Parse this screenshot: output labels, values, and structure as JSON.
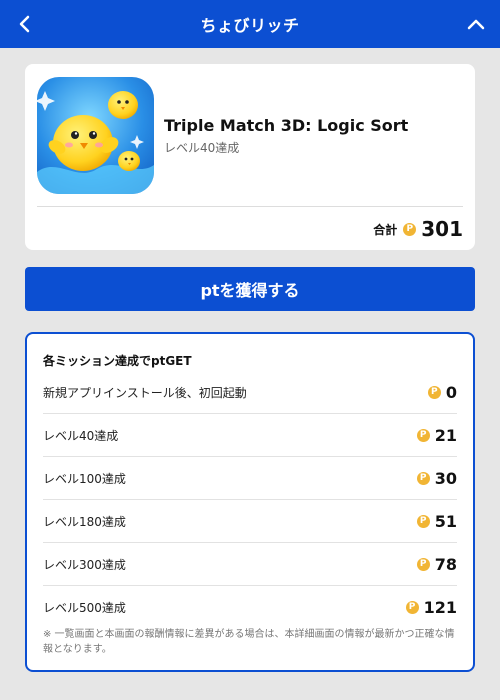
{
  "header": {
    "title": "ちょびリッチ"
  },
  "app": {
    "name": "Triple Match 3D: Logic Sort",
    "subtitle": "レベル40達成",
    "total_label": "合計",
    "total_value": "301"
  },
  "coin_symbol": "P",
  "cta": {
    "label": "ptを獲得する"
  },
  "missions": {
    "title": "各ミッション達成でptGET",
    "items": [
      {
        "label": "新規アプリインストール後、初回起動",
        "value": "0"
      },
      {
        "label": "レベル40達成",
        "value": "21"
      },
      {
        "label": "レベル100達成",
        "value": "30"
      },
      {
        "label": "レベル180達成",
        "value": "51"
      },
      {
        "label": "レベル300達成",
        "value": "78"
      },
      {
        "label": "レベル500達成",
        "value": "121"
      }
    ],
    "note": "※ 一覧画面と本画面の報酬情報に差異がある場合は、本詳細画面の情報が最新かつ正確な情報となります。"
  },
  "colors": {
    "brand": "#0c4fd2",
    "coin": "#f1b534"
  },
  "icons": {
    "back": "chevron-left-icon",
    "collapse": "chevron-up-icon",
    "coin": "point-coin-icon"
  }
}
